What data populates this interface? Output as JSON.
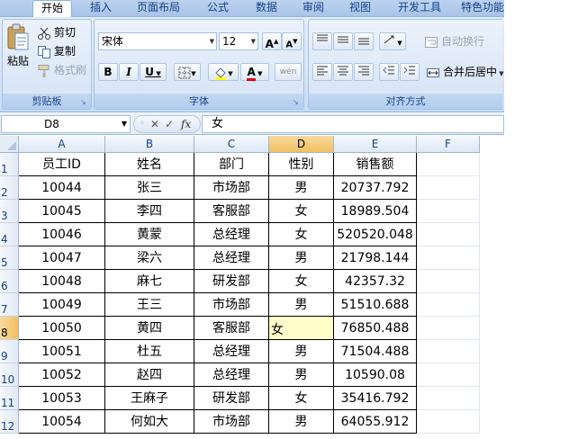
{
  "ribbon": {
    "tabs": [
      "开始",
      "插入",
      "页面布局",
      "公式",
      "数据",
      "审阅",
      "视图",
      "开发工具",
      "特色功能"
    ],
    "clipboard": {
      "label": "剪贴板",
      "paste": "粘贴",
      "cut": "剪切",
      "copy": "复制",
      "format_painter": "格式刷"
    },
    "font": {
      "label": "字体",
      "name": "宋体",
      "size": "12",
      "bold": "B",
      "italic": "I",
      "underline": "U",
      "grow": "A",
      "shrink": "A",
      "font_color": "A",
      "phonetic": "wén"
    },
    "alignment": {
      "label": "对齐方式",
      "wrap_text": "自动换行",
      "merge_center": "合并后居中"
    }
  },
  "formula_bar": {
    "name_box": "D8",
    "fx": "fx",
    "value": "女"
  },
  "columns": [
    "A",
    "B",
    "C",
    "D",
    "E",
    "F"
  ],
  "rows": [
    "1",
    "2",
    "3",
    "4",
    "5",
    "6",
    "7",
    "8",
    "9",
    "10",
    "11",
    "12"
  ],
  "table": [
    [
      "员工ID",
      "姓名",
      "部门",
      "性别",
      "销售额"
    ],
    [
      "10044",
      "张三",
      "市场部",
      "男",
      "20737.792"
    ],
    [
      "10045",
      "李四",
      "客服部",
      "女",
      "18989.504"
    ],
    [
      "10046",
      "黄蒙",
      "总经理",
      "女",
      "520520.048"
    ],
    [
      "10047",
      "梁六",
      "总经理",
      "男",
      "21798.144"
    ],
    [
      "10048",
      "麻七",
      "研发部",
      "女",
      "42357.32"
    ],
    [
      "10049",
      "王三",
      "市场部",
      "男",
      "51510.688"
    ],
    [
      "10050",
      "黄四",
      "客服部",
      "女",
      "76850.488"
    ],
    [
      "10051",
      "杜五",
      "总经理",
      "男",
      "71504.488"
    ],
    [
      "10052",
      "赵四",
      "总经理",
      "男",
      "10590.08"
    ],
    [
      "10053",
      "王麻子",
      "研发部",
      "女",
      "35416.792"
    ],
    [
      "10054",
      "何如大",
      "市场部",
      "男",
      "64055.912"
    ]
  ],
  "active_cell": {
    "col": "D",
    "row": "8"
  },
  "colors": {
    "selection_header": "#f1c15f",
    "active_cell_fill": "#fffdc8",
    "ribbon_text": "#15428b"
  }
}
